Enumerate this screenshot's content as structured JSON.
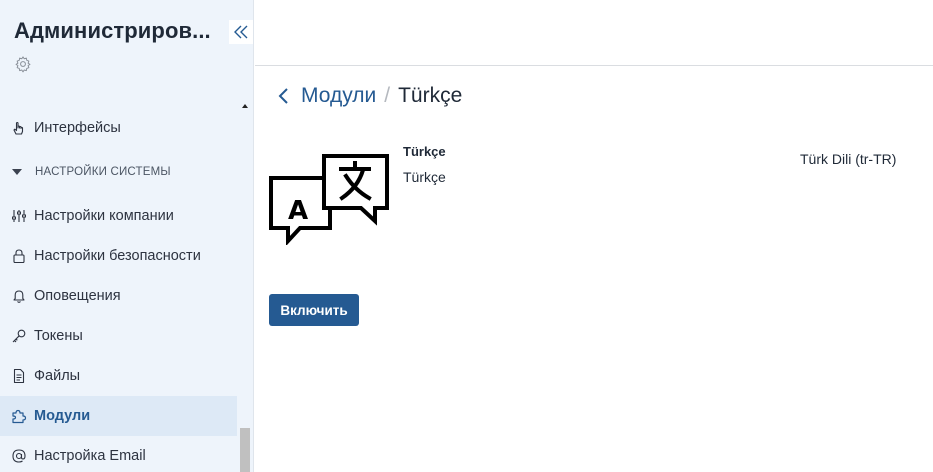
{
  "sidebar": {
    "title": "Администриров...",
    "items": [
      {
        "label": "Интерфейсы",
        "icon": "hand-pointer-icon"
      },
      {
        "label": "Настройки компании",
        "icon": "sliders-icon"
      },
      {
        "label": "Настройки безопасности",
        "icon": "lock-icon"
      },
      {
        "label": "Оповещения",
        "icon": "bell-icon"
      },
      {
        "label": "Токены",
        "icon": "key-icon"
      },
      {
        "label": "Файлы",
        "icon": "file-icon"
      },
      {
        "label": "Модули",
        "icon": "puzzle-icon",
        "active": true
      },
      {
        "label": "Настройка Email",
        "icon": "at-sign-icon"
      }
    ],
    "section": "НАСТРОЙКИ СИСТЕМЫ"
  },
  "breadcrumb": {
    "parent": "Модули",
    "separator": "/",
    "current": "Türkçe"
  },
  "module": {
    "name": "Türkçe",
    "description": "Türkçe",
    "locale": "Türk Dili (tr-TR)",
    "icon": "translate-icon"
  },
  "actions": {
    "enable_label": "Включить"
  },
  "colors": {
    "accent": "#255a92",
    "sidebar_bg": "#eef4fb",
    "active_item_bg": "#dde9f6"
  }
}
